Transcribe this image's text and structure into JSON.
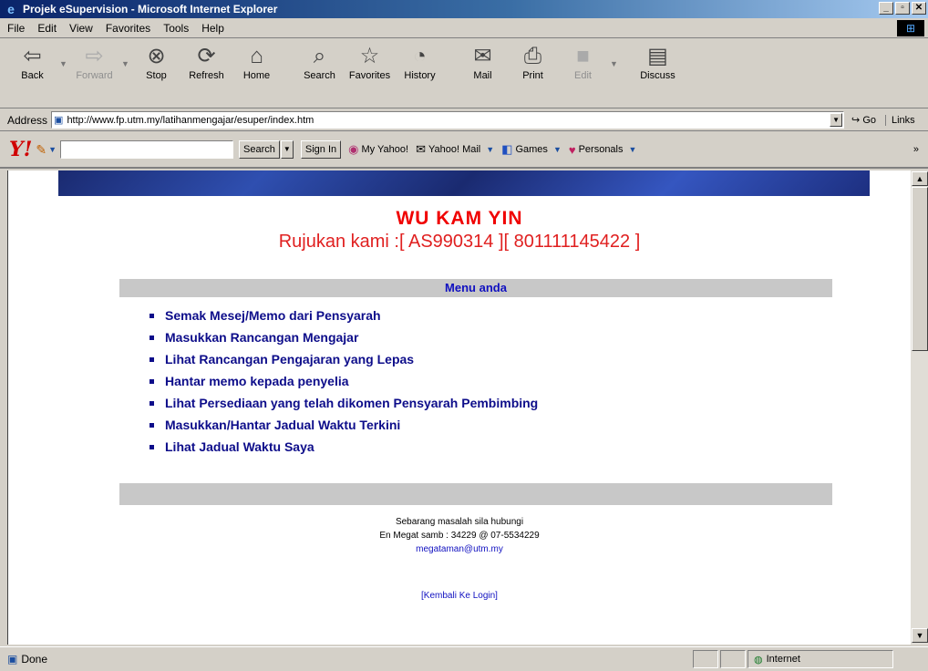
{
  "window": {
    "title": "Projek eSupervision - Microsoft Internet Explorer",
    "min_glyph": "_",
    "max_glyph": "ᗰ",
    "close_glyph": "✕"
  },
  "menubar": {
    "items": [
      "File",
      "Edit",
      "View",
      "Favorites",
      "Tools",
      "Help"
    ]
  },
  "toolbar": {
    "back": "Back",
    "forward": "Forward",
    "stop": "Stop",
    "refresh": "Refresh",
    "home": "Home",
    "search": "Search",
    "favorites": "Favorites",
    "history": "History",
    "mail": "Mail",
    "print": "Print",
    "edit": "Edit",
    "discuss": "Discuss"
  },
  "addressbar": {
    "label": "Address",
    "url": "http://www.fp.utm.my/latihanmengajar/esuper/index.htm",
    "go": "Go",
    "links": "Links"
  },
  "yahoobar": {
    "logo": "Y!",
    "search_button": "Search",
    "sign_in": "Sign In",
    "my_yahoo": "My Yahoo!",
    "yahoo_mail": "Yahoo! Mail",
    "games": "Games",
    "personals": "Personals",
    "more": "»"
  },
  "page": {
    "name": "WU KAM YIN",
    "reference": "Rujukan kami :[ AS990314 ][ 801111145422 ]",
    "menu_heading": "Menu anda",
    "menu_items": [
      "Semak Mesej/Memo dari Pensyarah",
      "Masukkan Rancangan Mengajar",
      "Lihat Rancangan Pengajaran yang Lepas",
      "Hantar memo kepada penyelia",
      "Lihat Persediaan yang telah dikomen Pensyarah Pembimbing",
      "Masukkan/Hantar Jadual Waktu Terkini",
      "Lihat Jadual Waktu Saya"
    ],
    "contact_line1": "Sebarang masalah sila hubungi",
    "contact_line2": "En Megat  samb : 34229 @ 07-5534229",
    "contact_email": "megataman@utm.my",
    "back_link": "[Kembali Ke Login]"
  },
  "statusbar": {
    "status": "Done",
    "zone": "Internet"
  }
}
